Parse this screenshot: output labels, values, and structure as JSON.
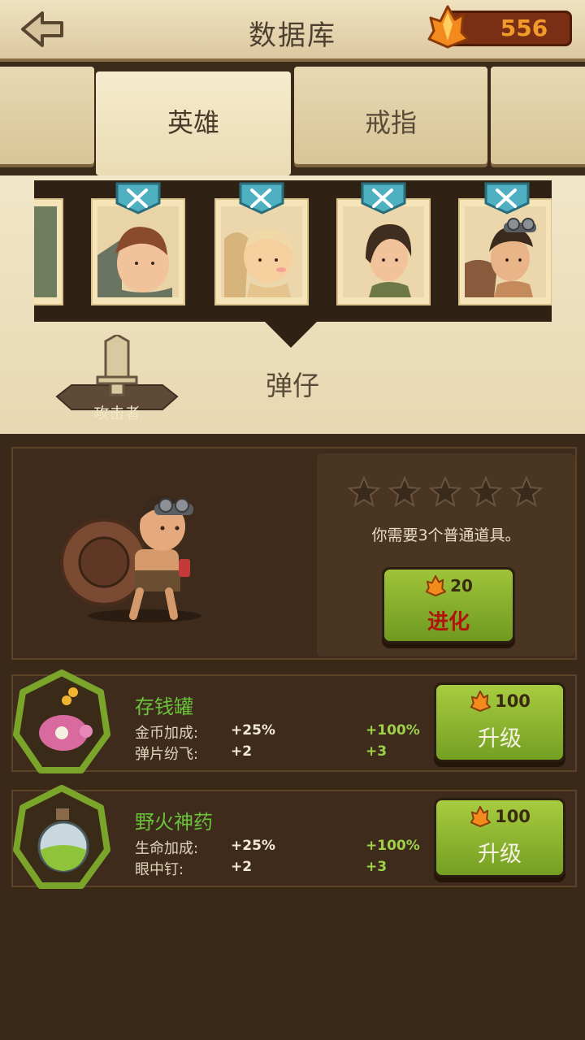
{
  "header": {
    "title": "数据库",
    "currency": {
      "value": "556",
      "icon": "crystal-icon",
      "color": "#f19b2b"
    }
  },
  "tabs": [
    {
      "label": ""
    },
    {
      "label": "英雄",
      "active": true
    },
    {
      "label": "戒指"
    },
    {
      "label": ""
    }
  ],
  "hero": {
    "class_label": "攻击者",
    "name": "弹仔"
  },
  "evolve": {
    "stars_total": 5,
    "stars_filled": 0,
    "requirement": "你需要3个普通道具。",
    "cost": "20",
    "label": "进化"
  },
  "items": [
    {
      "name": "存钱罐",
      "icon": "piggy-bank-icon",
      "stats": [
        {
          "label": "金币加成:",
          "value": "+25%",
          "next": "+100%"
        },
        {
          "label": "弹片纷飞:",
          "value": "+2",
          "next": "+3"
        }
      ],
      "upgrade_cost": "100",
      "upgrade_label": "升级"
    },
    {
      "name": "野火神药",
      "icon": "potion-icon",
      "stats": [
        {
          "label": "生命加成:",
          "value": "+25%",
          "next": "+100%"
        },
        {
          "label": "眼中钉:",
          "value": "+2",
          "next": "+3"
        }
      ],
      "upgrade_cost": "100",
      "upgrade_label": "升级"
    }
  ],
  "colors": {
    "accent_green": "#6bc23c",
    "button_green": "#8db52f",
    "evolve_red": "#b0140c",
    "wood_dark": "#3e2b1b"
  }
}
